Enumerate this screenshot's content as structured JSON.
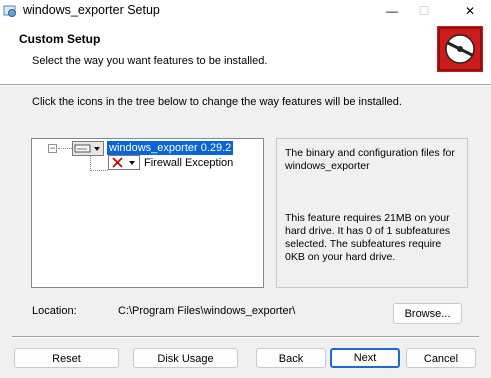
{
  "window": {
    "title": "windows_exporter Setup",
    "minimize": "—",
    "maximize": "☐",
    "close": "✕"
  },
  "header": {
    "title": "Custom Setup",
    "subtitle": "Select the way you want features to be installed."
  },
  "instruction": "Click the icons in the tree below to change the way features will be installed.",
  "tree": {
    "collapse_glyph": "−",
    "root": {
      "label": "windows_exporter 0.29.2",
      "selected": true
    },
    "children": [
      {
        "label": "Firewall Exception",
        "state": "not-installed"
      }
    ]
  },
  "description": {
    "line1": "The binary and configuration files for windows_exporter",
    "line2": "This feature requires 21MB on your hard drive. It has 0 of 1 subfeatures selected. The subfeatures require 0KB on your hard drive."
  },
  "location": {
    "label": "Location:",
    "path": "C:\\Program Files\\windows_exporter\\"
  },
  "buttons": {
    "browse": "Browse...",
    "reset": "Reset",
    "disk_usage": "Disk Usage",
    "back": "Back",
    "next": "Next",
    "cancel": "Cancel"
  },
  "colors": {
    "selection": "#0a64d6",
    "logo_red": "#cc1b1b",
    "default_button_border": "#1f6bc9"
  }
}
